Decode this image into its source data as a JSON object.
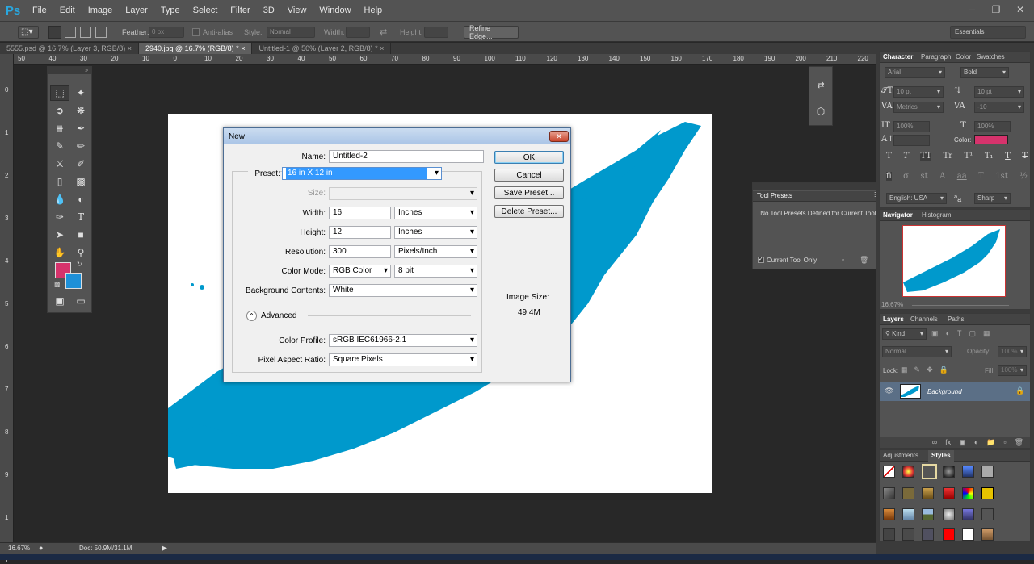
{
  "app": {
    "logo": "Ps",
    "menus": [
      "File",
      "Edit",
      "Image",
      "Layer",
      "Type",
      "Select",
      "Filter",
      "3D",
      "View",
      "Window",
      "Help"
    ],
    "window_controls": [
      "minimize-icon",
      "restore-icon",
      "close-icon"
    ]
  },
  "options": {
    "feather_label": "Feather:",
    "feather_value": "0 px",
    "antialias_label": "Anti-alias",
    "style_label": "Style:",
    "style_value": "Normal",
    "width_label": "Width:",
    "height_label": "Height:",
    "refine_label": "Refine Edge...",
    "workspace": "Essentials"
  },
  "tabs": [
    {
      "label": "5555.psd @ 16.7% (Layer 3, RGB/8)",
      "active": false
    },
    {
      "label": "2940.jpg @ 16.7% (RGB/8) *",
      "active": true
    },
    {
      "label": "Untitled-1 @ 50% (Layer 2, RGB/8) *",
      "active": false
    }
  ],
  "ruler": {
    "h": [
      "50",
      "40",
      "30",
      "20",
      "10",
      "0",
      "10",
      "20",
      "30",
      "40",
      "50",
      "60",
      "70",
      "80",
      "90",
      "100",
      "110",
      "120",
      "130",
      "140",
      "150",
      "160",
      "170",
      "180",
      "190",
      "200",
      "210",
      "220"
    ],
    "v": [
      "0",
      "1",
      "2",
      "3",
      "4",
      "5",
      "6",
      "7",
      "8",
      "9",
      "1",
      "1"
    ]
  },
  "dialog": {
    "title": "New",
    "name_label": "Name:",
    "name_value": "Untitled-2",
    "preset_label": "Preset:",
    "preset_value": "16 in X 12 in",
    "size_label": "Size:",
    "width_label": "Width:",
    "width_value": "16",
    "width_unit": "Inches",
    "height_label": "Height:",
    "height_value": "12",
    "height_unit": "Inches",
    "resolution_label": "Resolution:",
    "resolution_value": "300",
    "resolution_unit": "Pixels/Inch",
    "colormode_label": "Color Mode:",
    "colormode_value": "RGB Color",
    "bitdepth_value": "8 bit",
    "bgcontents_label": "Background Contents:",
    "bgcontents_value": "White",
    "advanced_label": "Advanced",
    "colorprofile_label": "Color Profile:",
    "colorprofile_value": "sRGB IEC61966-2.1",
    "pixelaspect_label": "Pixel Aspect Ratio:",
    "pixelaspect_value": "Square Pixels",
    "ok_label": "OK",
    "cancel_label": "Cancel",
    "save_preset_label": "Save Preset...",
    "delete_preset_label": "Delete Preset...",
    "image_size_label": "Image Size:",
    "image_size_value": "49.4M"
  },
  "tool_presets": {
    "title": "Tool Presets",
    "message": "No Tool Presets Defined for Current Tool.",
    "checkbox_label": "Current Tool Only"
  },
  "character": {
    "tabs": [
      "Character",
      "Paragraph",
      "Color",
      "Swatches"
    ],
    "font_family": "Arial",
    "font_style": "Bold",
    "font_size": "10 pt",
    "leading": "10 pt",
    "kerning": "Metrics",
    "tracking": "-10",
    "vscale": "100%",
    "hscale": "100%",
    "color_label": "Color:",
    "language": "English: USA",
    "aa_prefix": "a",
    "aa_method": "Sharp",
    "style_glyphs": [
      "T",
      "T",
      "TT",
      "Tr",
      "T¹",
      "T₁",
      "T",
      "T"
    ],
    "ot_glyphs": [
      "fi",
      "σ",
      "st",
      "A",
      "aa",
      "T",
      "1st",
      "½"
    ]
  },
  "navigator": {
    "tabs": [
      "Navigator",
      "Histogram"
    ],
    "zoom": "16.67%"
  },
  "layers": {
    "tabs": [
      "Layers",
      "Channels",
      "Paths"
    ],
    "kind": "Kind",
    "blend": "Normal",
    "opacity_label": "Opacity:",
    "opacity": "100%",
    "lock_label": "Lock:",
    "fill_label": "Fill:",
    "fill": "100%",
    "layer_name": "Background"
  },
  "adjustments": {
    "tabs": [
      "Adjustments",
      "Styles"
    ]
  },
  "status": {
    "zoom": "16.67%",
    "doc": "Doc: 50.9M/31.1M"
  },
  "colors": {
    "accent": "#0099cc",
    "foreground": "#d6336c",
    "background": "#1e90d8"
  }
}
